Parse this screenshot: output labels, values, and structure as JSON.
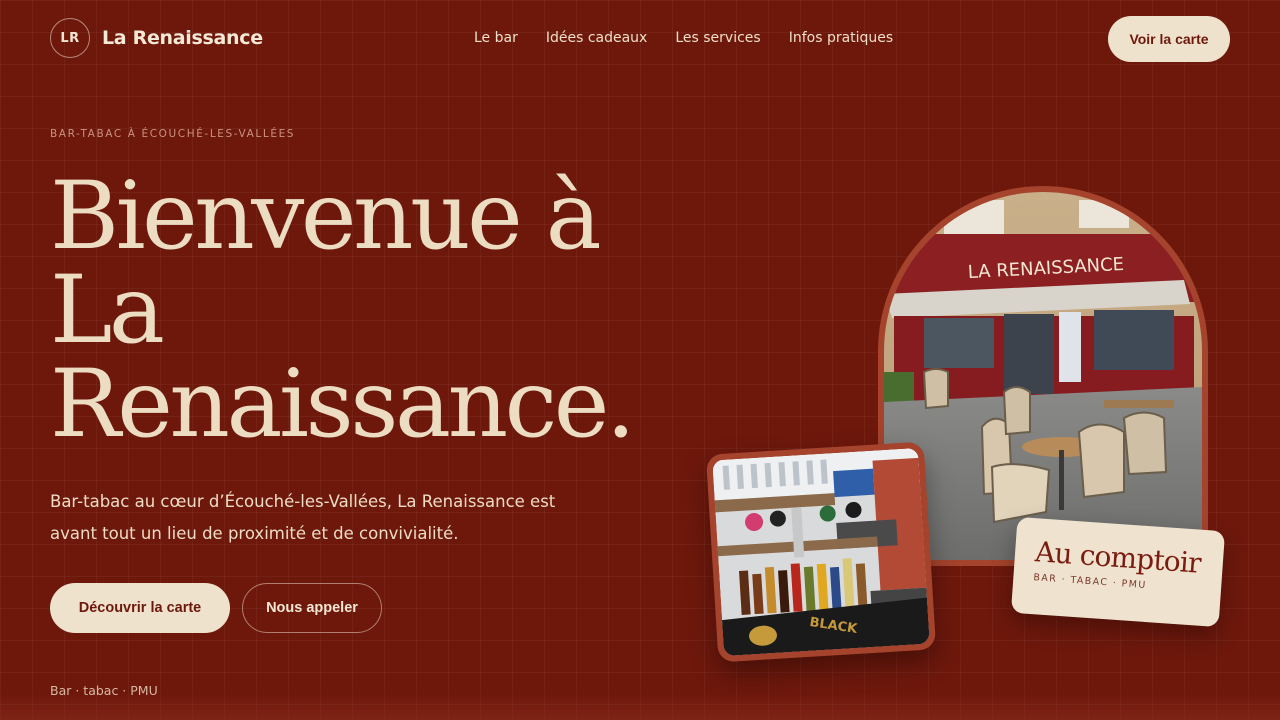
{
  "header": {
    "logo_initials": "LR",
    "brand_name": "La Renaissance",
    "nav": [
      {
        "label": "Le bar"
      },
      {
        "label": "Idées cadeaux"
      },
      {
        "label": "Les services"
      },
      {
        "label": "Infos pratiques"
      }
    ],
    "cta_label": "Voir la carte"
  },
  "hero": {
    "kicker": "BAR-TABAC À ÉCOUCHÉ-LES-VALLÉES",
    "title_lines": [
      "Bienvenue à",
      "La",
      "Renaissance."
    ],
    "lead": "Bar-tabac au cœur d’Écouché-les-Vallées, La Renaissance est avant tout un lieu de proximité et de convivialité.",
    "primary_button": "Découvrir la carte",
    "secondary_button": "Nous appeler",
    "tagline": "Bar · tabac · PMU"
  },
  "gallery": {
    "storefront_sign": "LA RENAISSANCE",
    "bar_mat_text": "BLACK",
    "label_title": "Au comptoir",
    "label_subtitle": "BAR · TABAC · PMU"
  },
  "colors": {
    "background": "#6e180c",
    "cream": "#efe2cc",
    "accent_frame": "#a5432d"
  }
}
